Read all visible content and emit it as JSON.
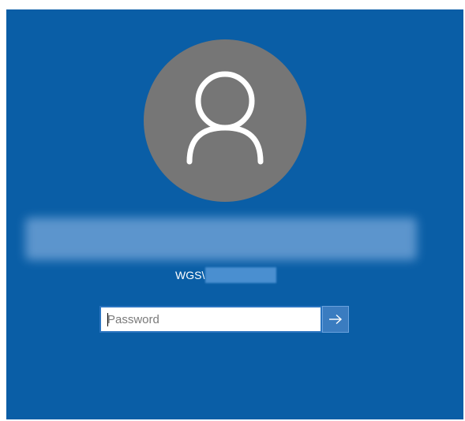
{
  "login": {
    "username": "",
    "domain_prefix": "WGS\\",
    "password_placeholder": "Password",
    "password_value": "",
    "submit_icon": "arrow-right-icon",
    "avatar_icon": "user-silhouette-icon"
  },
  "colors": {
    "background": "#0a5ea6",
    "avatar": "#767676",
    "submit_button": "#3a7cc0"
  }
}
